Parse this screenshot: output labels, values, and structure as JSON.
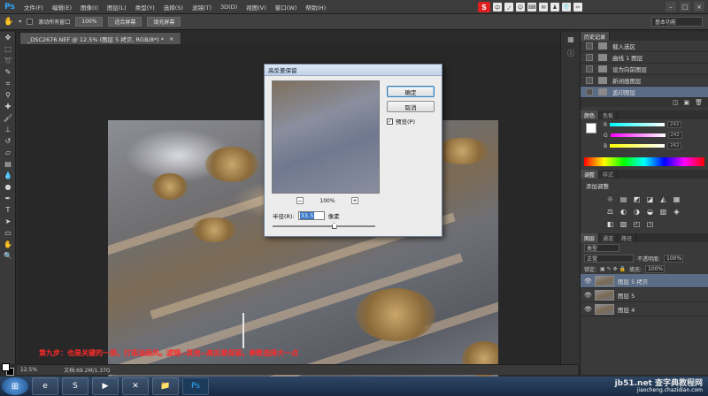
{
  "app": {
    "logo": "Ps"
  },
  "menu": [
    "文件(F)",
    "编辑(E)",
    "图像(I)",
    "图层(L)",
    "类型(Y)",
    "选择(S)",
    "滤镜(T)",
    "3D(D)",
    "视图(V)",
    "窗口(W)",
    "帮助(H)"
  ],
  "ime": {
    "logo": "S",
    "items": [
      "中",
      "ノ",
      "☺",
      "⌨",
      "✉",
      "♟",
      "👕",
      "✂"
    ]
  },
  "options": {
    "scroll_all_label": "滚动所有窗口",
    "btn_100": "100%",
    "btn_fit": "适合屏幕",
    "btn_fill": "填充屏幕",
    "workspace": "基本功能"
  },
  "document": {
    "tab_title": "_DSC2676.NEF @ 12.5% (图层 5 拷贝, RGB/8*) *",
    "close": "×"
  },
  "dialog": {
    "title": "高反差保留",
    "ok": "确定",
    "cancel": "取消",
    "preview_label": "预览(P)",
    "preview_checked": "✓",
    "zoom": "100%",
    "zoom_minus": "−",
    "zoom_plus": "+",
    "radius_label": "半径(R):",
    "radius_value": "33.5",
    "radius_unit": "像素",
    "radius_fraction": 0.6
  },
  "caption": "第九步：也是关键的一部。打造油画风。滤镜--其他--高反差保留。参数选择大一点",
  "status": {
    "zoom": "12.5%",
    "doc": "文档:69.2M/1.37G"
  },
  "history": {
    "tabs": [
      "历史记录"
    ],
    "items": [
      "载入选区",
      "曲线 1 图层",
      "设为向前图层",
      "新闭画图层",
      "盖印图层"
    ],
    "active_index": 4,
    "footer": [
      "◫",
      "▣",
      "🗑"
    ]
  },
  "color": {
    "tabs": [
      "颜色",
      "色板"
    ],
    "channels": [
      {
        "name": "R",
        "value": "242"
      },
      {
        "name": "G",
        "value": "242"
      },
      {
        "name": "B",
        "value": "242"
      }
    ]
  },
  "adjustments": {
    "tabs": [
      "调整",
      "样式"
    ],
    "label": "添加调整",
    "icons": [
      "☼",
      "▤",
      "◩",
      "◪",
      "◭",
      "▦",
      "⚖",
      "◐",
      "◑",
      "◒",
      "▥",
      "◈",
      "◧",
      "▨",
      "◰",
      "◳"
    ]
  },
  "layers": {
    "tabs": [
      "图层",
      "通道",
      "路径"
    ],
    "kind": "类型",
    "blend_mode": "正常",
    "opacity_label": "不透明度:",
    "opacity": "100%",
    "lock_label": "锁定:",
    "fill_label": "填充:",
    "fill": "100%",
    "items": [
      {
        "name": "图层 5 拷贝",
        "active": true
      },
      {
        "name": "图层 5",
        "active": false
      },
      {
        "name": "图层 4",
        "active": false
      }
    ]
  },
  "taskbar": {
    "start": "⊞",
    "apps": [
      "e",
      "S",
      "▶",
      "✕",
      "📁",
      "Ps"
    ],
    "watermark": "jb51.net 查字典教程网",
    "sub": "jiaocheng.chazidian.com"
  }
}
